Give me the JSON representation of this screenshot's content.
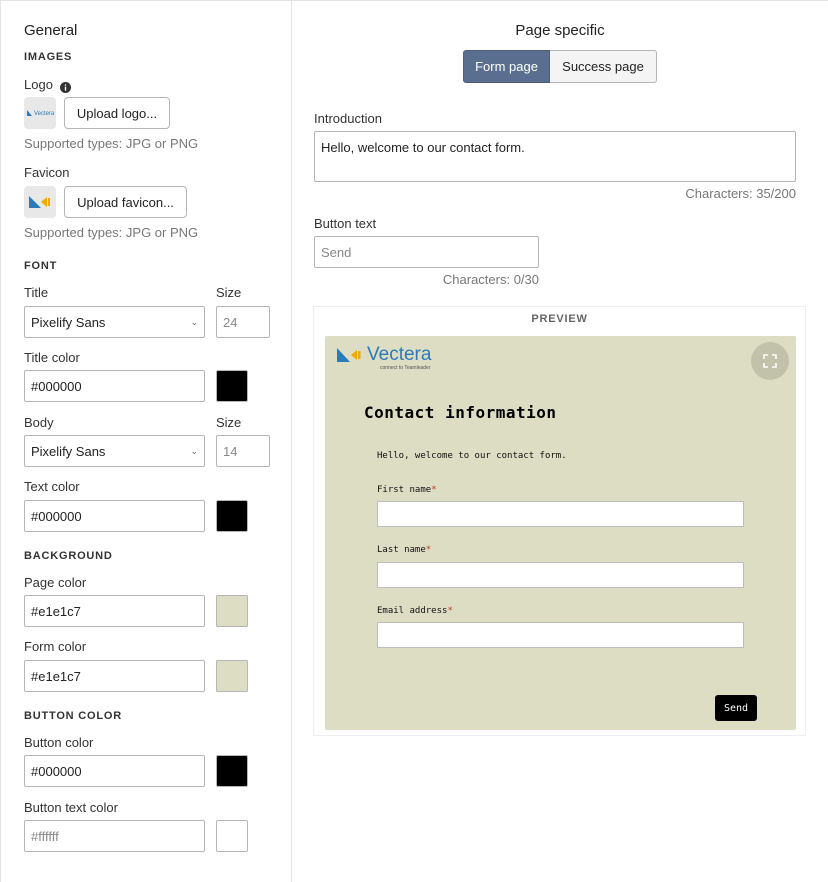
{
  "general": {
    "title": "General",
    "images": {
      "section_label": "IMAGES",
      "logo_label": "Logo",
      "logo_button": "Upload logo...",
      "logo_hint": "Supported types: JPG or PNG",
      "favicon_label": "Favicon",
      "favicon_button": "Upload favicon...",
      "favicon_hint": "Supported types: JPG or PNG"
    },
    "font": {
      "section_label": "FONT",
      "title_label": "Title",
      "title_font": "Pixelify Sans",
      "size_label": "Size",
      "title_size": "24",
      "title_color_label": "Title color",
      "title_color": "#000000",
      "body_label": "Body",
      "body_font": "Pixelify Sans",
      "body_size_label": "Size",
      "body_size": "14",
      "text_color_label": "Text color",
      "text_color": "#000000"
    },
    "background": {
      "section_label": "BACKGROUND",
      "page_color_label": "Page color",
      "page_color": "#e1e1c7",
      "form_color_label": "Form color",
      "form_color": "#e1e1c7"
    },
    "button_color": {
      "section_label": "BUTTON COLOR",
      "button_color_label": "Button color",
      "button_color": "#000000",
      "button_text_color_label": "Button text color",
      "button_text_color_placeholder": "#ffffff"
    }
  },
  "page_specific": {
    "title": "Page specific",
    "tabs": [
      {
        "label": "Form page",
        "active": true
      },
      {
        "label": "Success page",
        "active": false
      }
    ],
    "introduction_label": "Introduction",
    "introduction_value": "Hello, welcome to our contact form.",
    "introduction_counter": "Characters: 35/200",
    "button_text_label": "Button text",
    "button_text_placeholder": "Send",
    "button_text_counter": "Characters: 0/30"
  },
  "preview": {
    "label": "PREVIEW",
    "brand_name": "Vectera",
    "brand_tagline": "connect to Teamleader",
    "form_title": "Contact information",
    "intro_text": "Hello, welcome to our contact form.",
    "fields": [
      {
        "label": "First name",
        "required_mark": "*"
      },
      {
        "label": "Last name",
        "required_mark": "*"
      },
      {
        "label": "Email address",
        "required_mark": "*"
      }
    ],
    "send_label": "Send"
  },
  "colors": {
    "swatch_title": "#000000",
    "swatch_text": "#000000",
    "swatch_page": "#dcddc3",
    "swatch_form": "#dcddc3",
    "swatch_button": "#000000",
    "swatch_button_text": "#ffffff",
    "tab_active": "#5a6f8f",
    "form_background": "#dcddc3"
  },
  "icons": {
    "info": "info-icon",
    "chevron": "chevron-down-icon",
    "expand": "expand-icon",
    "logo": "vectera-logo-icon"
  }
}
